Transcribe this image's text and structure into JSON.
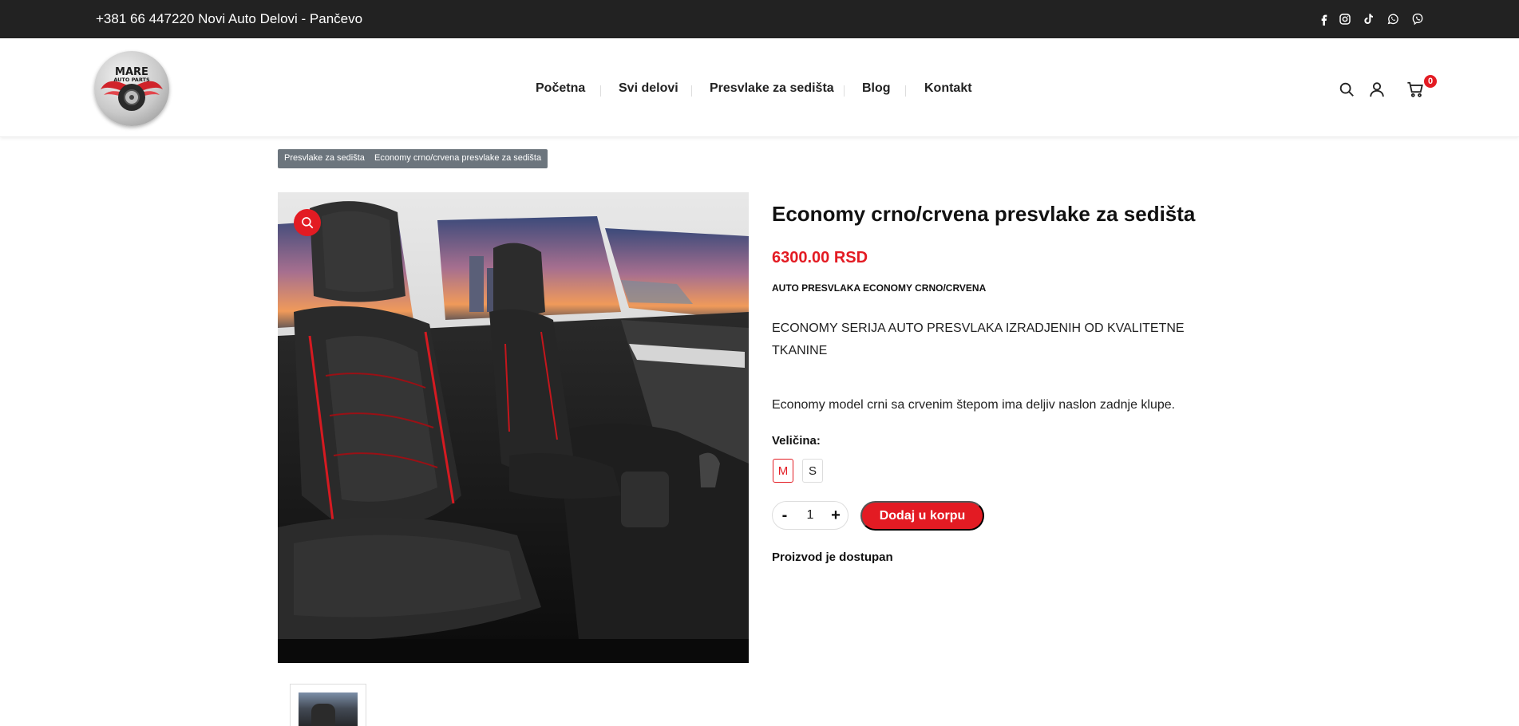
{
  "topbar": {
    "contact_text": "+381 66 447220 Novi Auto Delovi - Pančevo",
    "social_icons": [
      "facebook-icon",
      "instagram-icon",
      "tiktok-icon",
      "whatsapp-icon",
      "viber-icon"
    ]
  },
  "header": {
    "logo_line1": "MARE",
    "logo_line2": "AUTO PARTS",
    "nav": [
      "Početna",
      "Svi delovi",
      "Presvlake za sedišta",
      "Blog",
      "Kontakt"
    ],
    "cart_count": "0",
    "icons": [
      "search-icon",
      "user-icon",
      "cart-icon"
    ]
  },
  "breadcrumb": [
    "Presvlake za sedišta",
    "Economy crno/crvena presvlake za sedišta"
  ],
  "product": {
    "title": "Economy crno/crvena presvlake za sedišta",
    "price": "6300.00 RSD",
    "subtitle": "AUTO PRESVLAKA ECONOMY CRNO/CRVENA",
    "description": "ECONOMY SERIJA AUTO PRESVLAKA IZRADJENIH OD KVALITETNE TKANINE",
    "description2": "Economy model crni sa crvenim štepom ima deljiv naslon zadnje klupe.",
    "size_label": "Veličina:",
    "sizes": [
      "M",
      "S"
    ],
    "selected_size": "M",
    "qty_minus": "-",
    "quantity": "1",
    "qty_plus": "+",
    "add_to_cart": "Dodaj u korpu",
    "availability": "Proizvod je dostupan"
  },
  "colors": {
    "accent": "#e31b23",
    "topbar_bg": "#222222",
    "breadcrumb_bg": "#6c757d"
  }
}
